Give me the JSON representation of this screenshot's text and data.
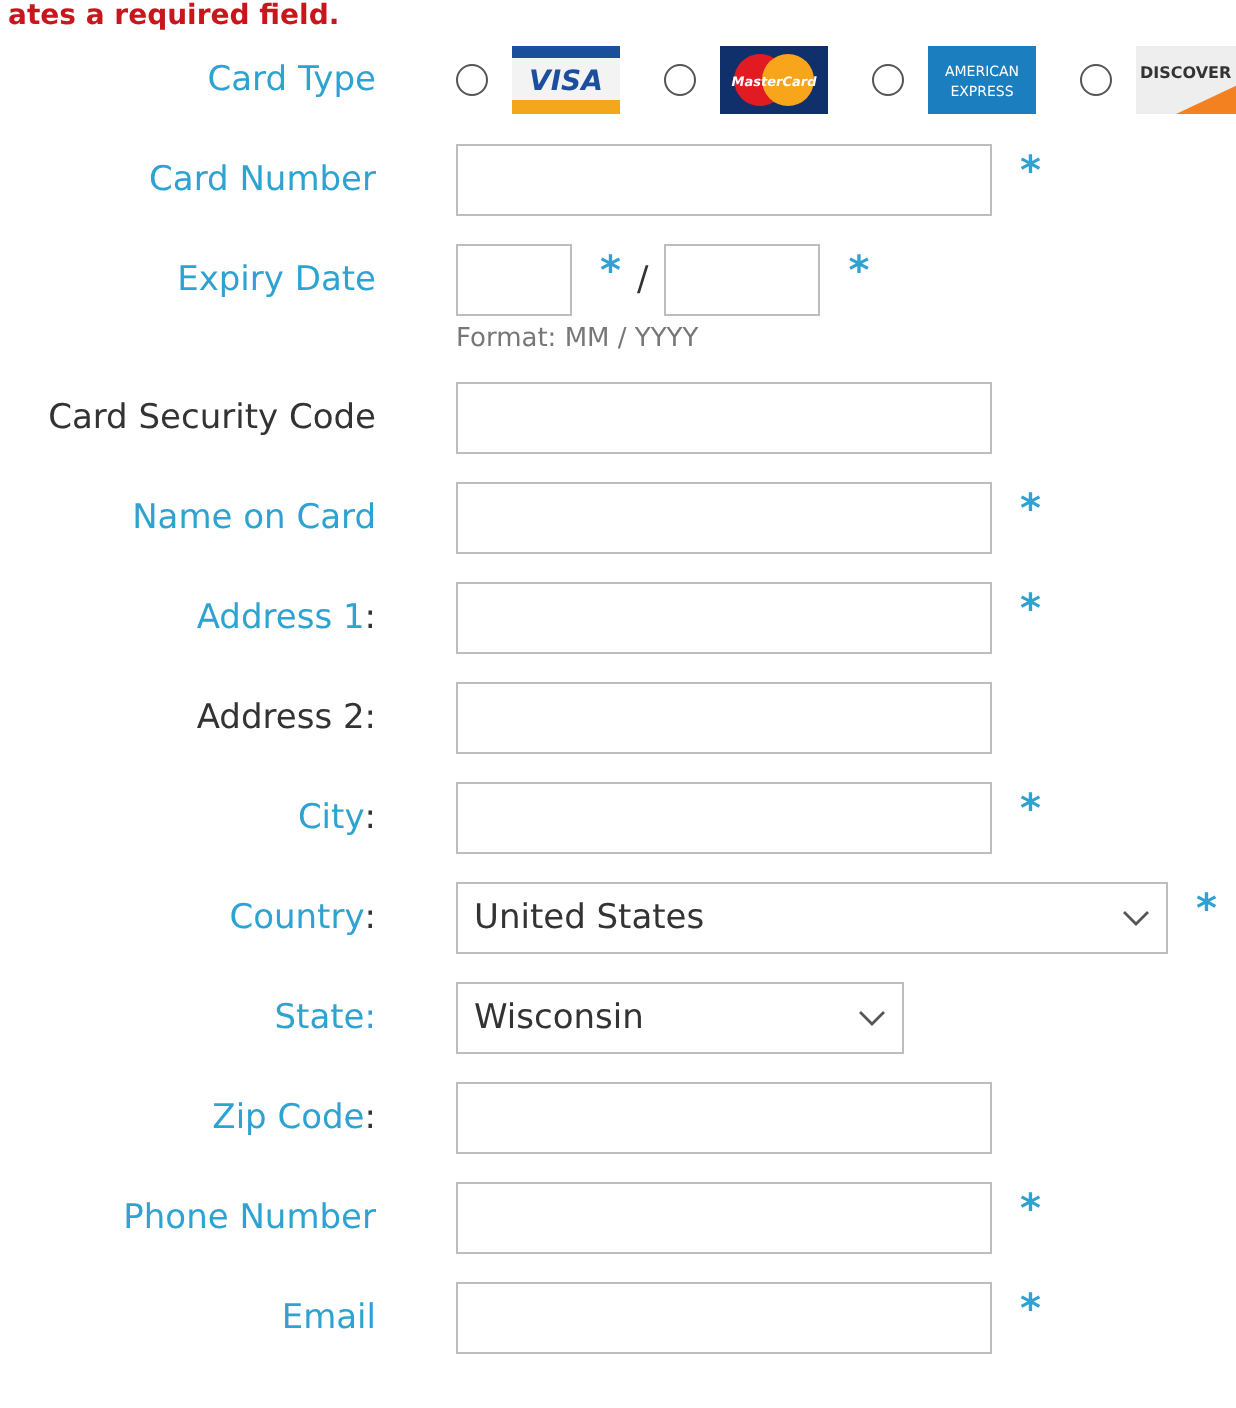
{
  "notice": "ates a required field.",
  "card_type": {
    "label": "Card Type",
    "options": [
      {
        "kind": "visa",
        "text": "VISA",
        "selected": false
      },
      {
        "kind": "mastercard",
        "text": "MasterCard",
        "selected": false
      },
      {
        "kind": "amex",
        "text": "AMERICAN EXPRESS",
        "selected": false
      },
      {
        "kind": "discover",
        "text": "DISCOVER",
        "selected": false
      }
    ]
  },
  "fields": [
    {
      "kind": "text",
      "label": "Card Number",
      "accent": true,
      "marks": [
        "*"
      ]
    },
    {
      "kind": "expiry",
      "label": "Expiry Date",
      "accent": true,
      "marks": [
        "*",
        "*"
      ],
      "separator": "/",
      "hint": "Format: MM / YYYY"
    },
    {
      "kind": "text",
      "label": "Card Security Code",
      "accent": false
    },
    {
      "kind": "text",
      "label": "Name on Card",
      "accent": true,
      "marks": [
        "*"
      ]
    },
    {
      "kind": "text",
      "label": "Address 1",
      "colon": ":",
      "accent": true,
      "marks": [
        "*"
      ]
    },
    {
      "kind": "text",
      "label": "Address 2:",
      "accent": false
    },
    {
      "kind": "text",
      "label": "City",
      "colon": ":",
      "accent": true,
      "marks": [
        "*"
      ]
    },
    {
      "kind": "select",
      "label": "Country",
      "colon": ":",
      "accent": true,
      "marks": [
        "*"
      ],
      "value": "United States",
      "wide": true
    },
    {
      "kind": "select",
      "label": "State:",
      "accent": true,
      "value": "Wisconsin",
      "wide": false
    },
    {
      "kind": "text",
      "label": "Zip Code",
      "colon": ":",
      "accent": true
    },
    {
      "kind": "text",
      "label": "Phone Number",
      "accent": true,
      "marks": [
        "*"
      ]
    },
    {
      "kind": "text",
      "label": "Email",
      "accent": true,
      "marks": [
        "*"
      ]
    }
  ]
}
